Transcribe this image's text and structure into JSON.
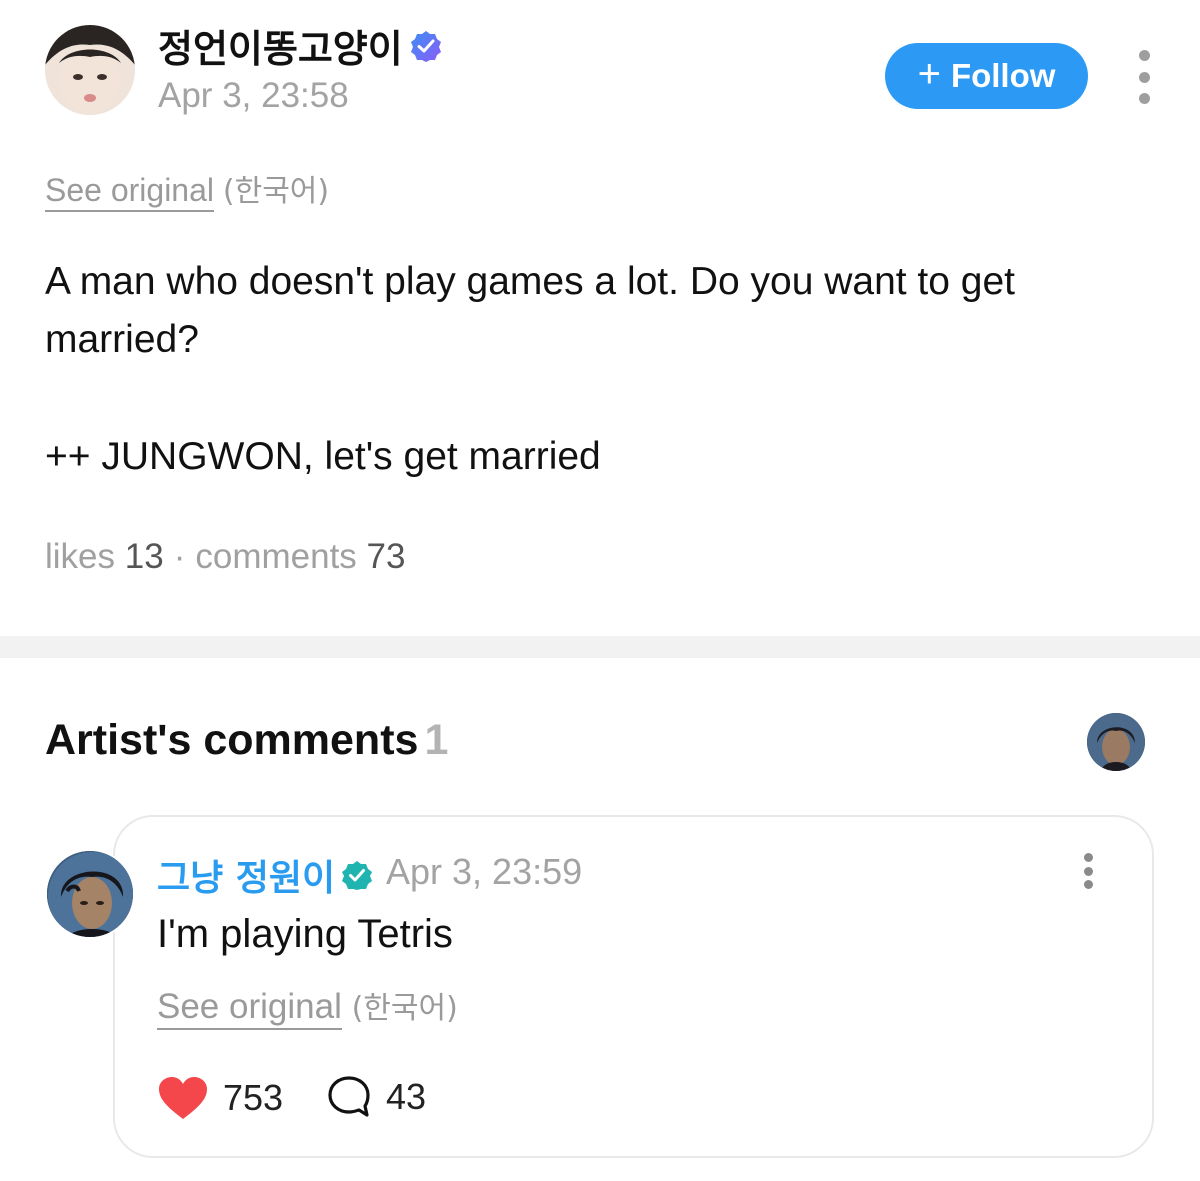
{
  "post": {
    "author": "정언이똥고양이",
    "timestamp": "Apr 3, 23:58",
    "follow_label": "Follow",
    "see_original": "See original",
    "language": "(한국어)",
    "body_lines": [
      "A man who doesn't play games a lot. Do you want to get",
      "married?"
    ],
    "body_extra": "++ JUNGWON, let's get married",
    "likes_label": "likes",
    "likes_count": "13",
    "separator": "·",
    "comments_label": "comments",
    "comments_count": "73"
  },
  "artist_comments": {
    "title": "Artist's comments",
    "count": "1"
  },
  "comment": {
    "author": "그냥 정원이",
    "timestamp": "Apr 3, 23:59",
    "text": "I'm playing Tetris",
    "see_original": "See original",
    "language": "(한국어)",
    "likes": "753",
    "replies": "43"
  },
  "colors": {
    "accent": "#2c9af5",
    "author_blue": "#2a9cf0",
    "heart": "#f4474b",
    "badge_blue": "#3a8ff5",
    "badge_purple": "#8d5cf6",
    "muted": "#a3a3a3"
  },
  "icons": {
    "post_badge": "verified-badge-icon",
    "comment_badge": "verified-badge-icon",
    "more": "more-vertical-icon",
    "like": "heart-icon",
    "reply": "speech-bubble-icon"
  }
}
